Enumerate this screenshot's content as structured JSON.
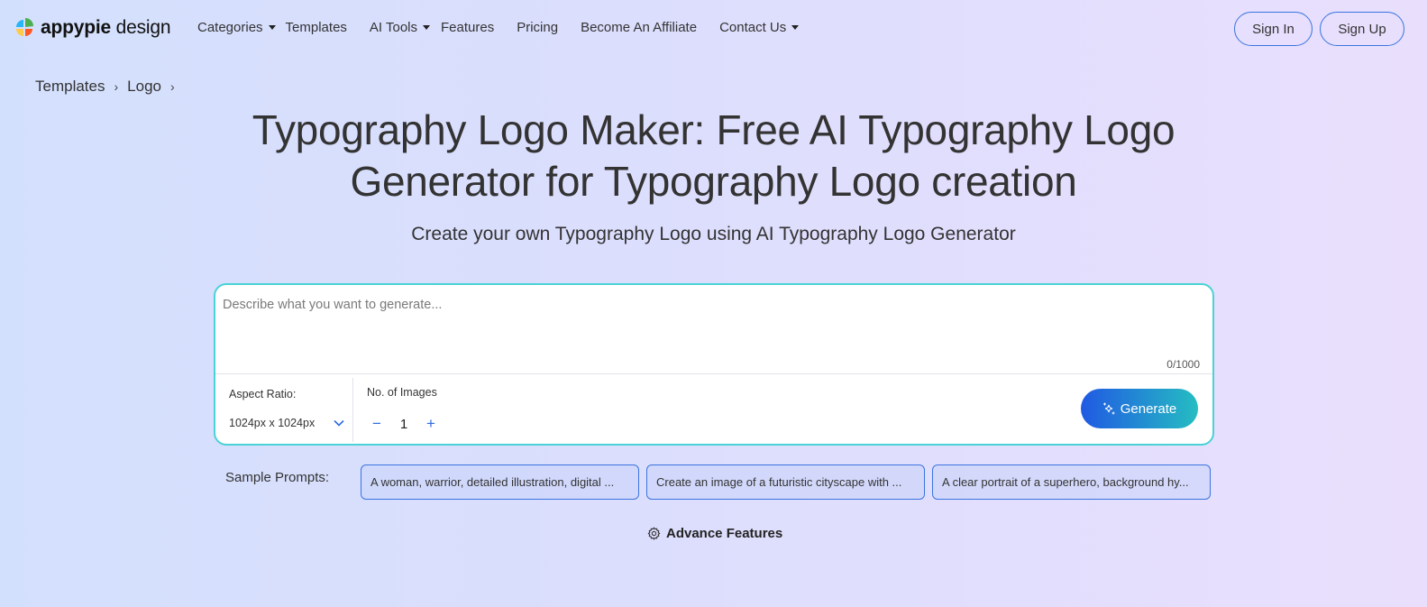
{
  "header": {
    "logo": {
      "brand": "appypie",
      "suffix": "design",
      "icon": "appypie-logo-icon"
    },
    "nav": [
      {
        "label": "Categories",
        "has_dropdown": true
      },
      {
        "label": "Templates",
        "has_dropdown": false
      },
      {
        "label": "AI Tools",
        "has_dropdown": true
      },
      {
        "label": "Features",
        "has_dropdown": false
      },
      {
        "label": "Pricing",
        "has_dropdown": false
      },
      {
        "label": "Become An Affiliate",
        "has_dropdown": false
      },
      {
        "label": "Contact Us",
        "has_dropdown": true
      }
    ],
    "sign_in": "Sign In",
    "sign_up": "Sign Up"
  },
  "breadcrumb": [
    {
      "label": "Templates"
    },
    {
      "label": "Logo"
    }
  ],
  "hero": {
    "title_line1": "Typography Logo Maker: Free AI Typography Logo",
    "title_line2": "Generator for Typography Logo creation",
    "subtitle": "Create your own Typography Logo using AI Typography Logo Generator"
  },
  "prompt": {
    "value": "",
    "placeholder": "Describe what you want to generate...",
    "counter": "0/1000",
    "aspect_label": "Aspect Ratio:",
    "aspect_value": "1024px x 1024px",
    "num_images_label": "No. of Images",
    "num_images_value": "1",
    "minus": "−",
    "plus": "+",
    "generate_label": "Generate"
  },
  "samples": {
    "label": "Sample Prompts:",
    "items": [
      "A woman, warrior, detailed illustration, digital ...",
      "Create an image of a futuristic cityscape with ...",
      "A clear portrait of a superhero, background hy..."
    ]
  },
  "advance": {
    "label": "Advance Features"
  },
  "colors": {
    "accent": "#3a74e0",
    "box_border": "#4ad2d6",
    "generate_gradient_start": "#2059e3",
    "generate_gradient_end": "#25bdc2",
    "bg_left": "#d3e0fd",
    "bg_right": "#e9dffd"
  }
}
